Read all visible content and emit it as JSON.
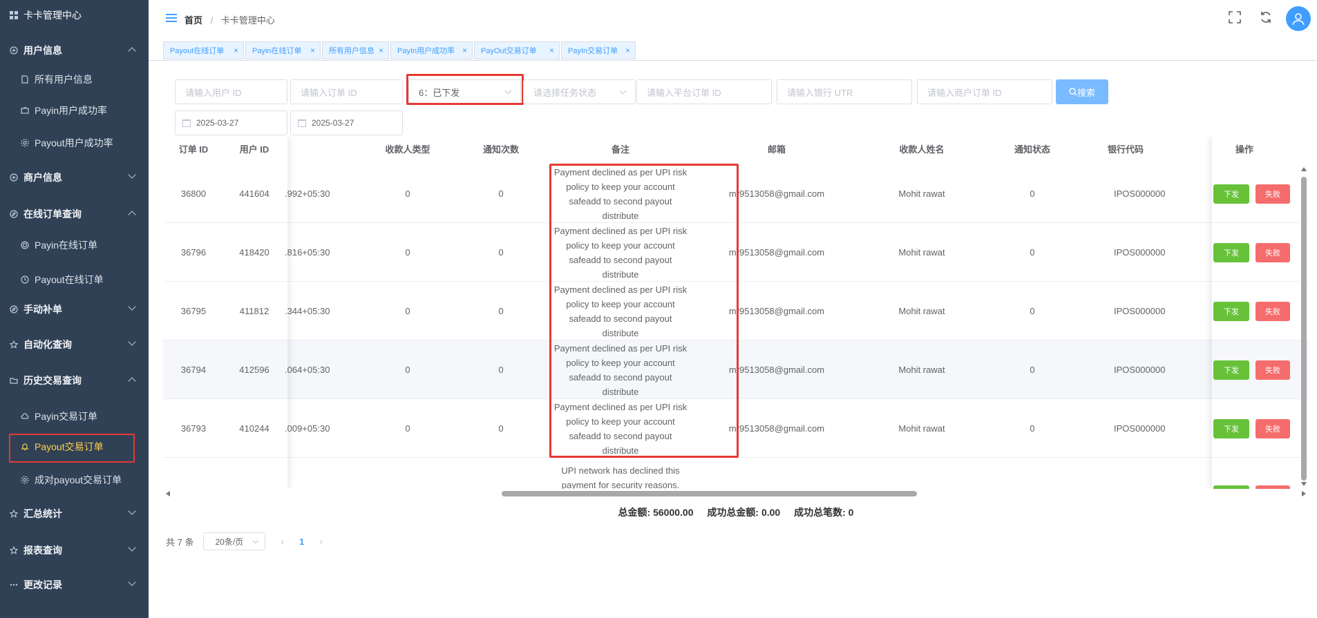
{
  "sidebar": {
    "brand": "卡卡管理中心",
    "items": [
      {
        "label": "用户信息",
        "type": "group",
        "icon": "plus-circle-icon",
        "expanded": true
      },
      {
        "label": "所有用户信息",
        "type": "sub",
        "icon": "document-icon"
      },
      {
        "label": "Payin用户成功率",
        "type": "sub",
        "icon": "wallet-icon"
      },
      {
        "label": "Payout用户成功率",
        "type": "sub",
        "icon": "cog-icon"
      },
      {
        "label": "商户信息",
        "type": "group",
        "icon": "plus-circle-icon",
        "expanded": false
      },
      {
        "label": "在线订单查询",
        "type": "group",
        "icon": "compass-icon",
        "expanded": true
      },
      {
        "label": "Payin在线订单",
        "type": "sub",
        "icon": "coin-icon"
      },
      {
        "label": "Payout在线订单",
        "type": "sub",
        "icon": "clock-icon"
      },
      {
        "label": "手动补单",
        "type": "group",
        "icon": "compass-icon",
        "expanded": false
      },
      {
        "label": "自动化查询",
        "type": "group",
        "icon": "star-icon",
        "expanded": false
      },
      {
        "label": "历史交易查询",
        "type": "group",
        "icon": "folder-icon",
        "expanded": true
      },
      {
        "label": "Payin交易订单",
        "type": "sub",
        "icon": "cloud-icon"
      },
      {
        "label": "Payout交易订单",
        "type": "sub",
        "icon": "bell-icon",
        "active": true
      },
      {
        "label": "成对payout交易订单",
        "type": "sub",
        "icon": "cog-icon"
      },
      {
        "label": "汇总统计",
        "type": "group",
        "icon": "star-icon",
        "expanded": false
      },
      {
        "label": "报表查询",
        "type": "group",
        "icon": "star-icon",
        "expanded": false
      },
      {
        "label": "更改记录",
        "type": "group",
        "icon": "more-icon",
        "expanded": false
      }
    ]
  },
  "header": {
    "breadcrumb_home": "首页",
    "breadcrumb_sep": "/",
    "breadcrumb_current": "卡卡管理中心"
  },
  "tags": [
    {
      "label": "Payout在线订单"
    },
    {
      "label": "Payin在线订单"
    },
    {
      "label": "所有用户信息"
    },
    {
      "label": "PayIn用户成功率"
    },
    {
      "label": "PayOut交易订单"
    },
    {
      "label": "PayIn交易订单"
    }
  ],
  "filters": {
    "user_id_placeholder": "请输入用户 ID",
    "order_id_placeholder": "请输入订单 ID",
    "status_value": "6：已下发",
    "task_status_placeholder": "请选择任务状态",
    "platform_order_placeholder": "请输入平台订单 ID",
    "bank_utr_placeholder": "请输入银行 UTR",
    "merchant_order_placeholder": "请输入商户订单 ID",
    "search_label": "搜索",
    "date_start": "2025-03-27",
    "date_end": "2025-03-27"
  },
  "table": {
    "headers": {
      "order_id": "订单 ID",
      "user_id": "用户 ID",
      "payee_type": "收款人类型",
      "notify_count": "通知次数",
      "remark": "备注",
      "email": "邮箱",
      "payee_name": "收款人姓名",
      "notify_status": "通知状态",
      "bank_code": "银行代码",
      "actions": "操作"
    },
    "rows": [
      {
        "order_id": "36800",
        "user_id": "441604",
        "time": ".992+05:30",
        "payee_type": "0",
        "notify_count": "0",
        "remark": "Payment declined as per UPI risk policy to keep your account safeadd to second payout distribute",
        "email": "mr9513058@gmail.com",
        "payee_name": "Mohit rawat",
        "notify_status": "0",
        "bank_code": "IPOS000000",
        "btn_issue": "下发",
        "btn_fail": "失败"
      },
      {
        "order_id": "36796",
        "user_id": "418420",
        "time": ".816+05:30",
        "payee_type": "0",
        "notify_count": "0",
        "remark": "Payment declined as per UPI risk policy to keep your account safeadd to second payout distribute",
        "email": "mr9513058@gmail.com",
        "payee_name": "Mohit rawat",
        "notify_status": "0",
        "bank_code": "IPOS000000",
        "btn_issue": "下发",
        "btn_fail": "失败"
      },
      {
        "order_id": "36795",
        "user_id": "411812",
        "time": ".344+05:30",
        "payee_type": "0",
        "notify_count": "0",
        "remark": "Payment declined as per UPI risk policy to keep your account safeadd to second payout distribute",
        "email": "mr9513058@gmail.com",
        "payee_name": "Mohit rawat",
        "notify_status": "0",
        "bank_code": "IPOS000000",
        "btn_issue": "下发",
        "btn_fail": "失败"
      },
      {
        "order_id": "36794",
        "user_id": "412596",
        "time": ".064+05:30",
        "payee_type": "0",
        "notify_count": "0",
        "remark": "Payment declined as per UPI risk policy to keep your account safeadd to second payout distribute",
        "email": "mr9513058@gmail.com",
        "payee_name": "Mohit rawat",
        "notify_status": "0",
        "bank_code": "IPOS000000",
        "btn_issue": "下发",
        "btn_fail": "失败"
      },
      {
        "order_id": "36793",
        "user_id": "410244",
        "time": ".009+05:30",
        "payee_type": "0",
        "notify_count": "0",
        "remark": "Payment declined as per UPI risk policy to keep your account safeadd to second payout distribute",
        "email": "mr9513058@gmail.com",
        "payee_name": "Mohit rawat",
        "notify_status": "0",
        "bank_code": "IPOS000000",
        "btn_issue": "下发",
        "btn_fail": "失败"
      }
    ],
    "partial_row_remark": "UPI network has declined this payment for security reasons. Please contact your ba"
  },
  "totals": {
    "total_amount": "总金额: 56000.00",
    "success_amount": "成功总金额: 0.00",
    "success_count": "成功总笔数: 0"
  },
  "pager": {
    "total": "共 7 条",
    "page_size": "20条/页",
    "prev": "‹",
    "current": "1",
    "next": "›"
  },
  "colors": {
    "sidebar_bg": "#304156",
    "accent": "#409eff",
    "active_menu": "#ffd04b",
    "highlight": "#e53935",
    "success": "#67c23a",
    "danger": "#f56c6c"
  }
}
